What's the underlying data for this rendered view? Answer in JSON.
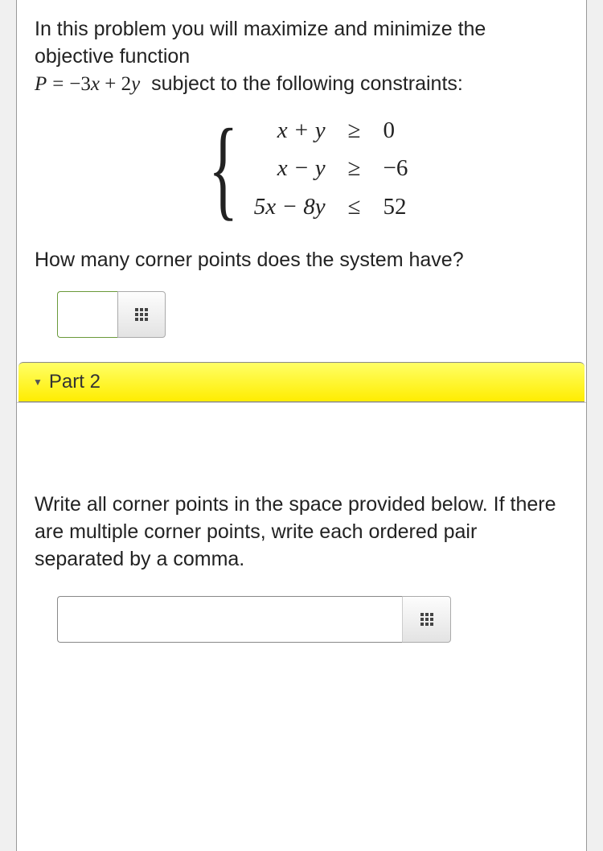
{
  "intro_1": "In this problem you will maximize and minimize the objective function",
  "obj_lhs": "P",
  "obj_eq": "=",
  "obj_rhs": "−3x + 2y",
  "intro_2": "subject to the following constraints:",
  "constraints": [
    {
      "lhs": "x + y",
      "op": "≥",
      "rhs": "0"
    },
    {
      "lhs": "x − y",
      "op": "≥",
      "rhs": "−6"
    },
    {
      "lhs": "5x − 8y",
      "op": "≤",
      "rhs": "52"
    }
  ],
  "question1": "How many corner points does the system have?",
  "input1_value": "",
  "part2_label": "Part 2",
  "question2": "Write all corner points in the space provided below. If there are multiple corner points, write each ordered pair separated by a comma.",
  "input2_value": ""
}
